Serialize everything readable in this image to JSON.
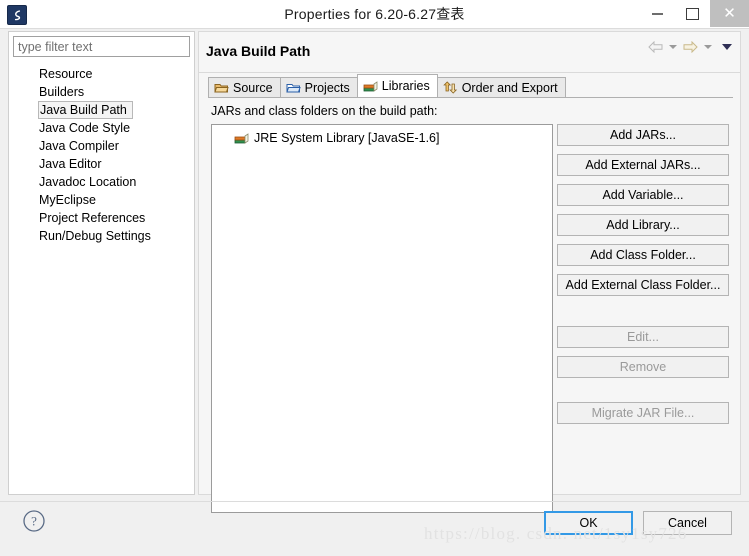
{
  "window": {
    "title": "Properties for 6.20-6.27查表",
    "app_icon": "myeclipse-icon",
    "controls": {
      "minimize": "minimize-icon",
      "maximize": "maximize-icon",
      "close": "close-icon"
    }
  },
  "sidebar": {
    "filter": {
      "placeholder": "type filter text",
      "value": ""
    },
    "items": [
      {
        "label": "Resource",
        "selected": false
      },
      {
        "label": "Builders",
        "selected": false
      },
      {
        "label": "Java Build Path",
        "selected": true
      },
      {
        "label": "Java Code Style",
        "selected": false
      },
      {
        "label": "Java Compiler",
        "selected": false
      },
      {
        "label": "Java Editor",
        "selected": false
      },
      {
        "label": "Javadoc Location",
        "selected": false
      },
      {
        "label": "MyEclipse",
        "selected": false
      },
      {
        "label": "Project References",
        "selected": false
      },
      {
        "label": "Run/Debug Settings",
        "selected": false
      }
    ]
  },
  "page": {
    "title": "Java Build Path",
    "nav": {
      "back": "back-arrow-icon",
      "back_menu": "back-dropdown-icon",
      "forward": "forward-arrow-icon",
      "forward_menu": "forward-dropdown-icon",
      "more": "view-menu-icon"
    },
    "tabs": [
      {
        "label": "Source",
        "icon": "source-folder-icon",
        "active": false
      },
      {
        "label": "Projects",
        "icon": "projects-folder-icon",
        "active": false
      },
      {
        "label": "Libraries",
        "icon": "libraries-books-icon",
        "active": true
      },
      {
        "label": "Order and Export",
        "icon": "order-export-icon",
        "active": false
      }
    ],
    "description": "JARs and class folders on the build path:",
    "entries": [
      {
        "label": "JRE System Library [JavaSE-1.6]",
        "icon": "libraries-books-icon"
      }
    ],
    "side_buttons": [
      {
        "label": "Add JARs...",
        "enabled": true
      },
      {
        "label": "Add External JARs...",
        "enabled": true
      },
      {
        "label": "Add Variable...",
        "enabled": true
      },
      {
        "label": "Add Library...",
        "enabled": true
      },
      {
        "label": "Add Class Folder...",
        "enabled": true
      },
      {
        "label": "Add External Class Folder...",
        "enabled": true
      },
      {
        "label": "Edit...",
        "enabled": false
      },
      {
        "label": "Remove",
        "enabled": false
      },
      {
        "label": "Migrate JAR File...",
        "enabled": false
      }
    ]
  },
  "footer": {
    "help": "help-icon",
    "ok_label": "OK",
    "cancel_label": "Cancel"
  },
  "watermark": "https://blog. csdn. net/1sy1sy726",
  "colors": {
    "accent": "#3399e6",
    "titlebar_bg": "#ffffff",
    "dialog_bg": "#f0f0f0",
    "panel_bg": "#f6f6f6",
    "close_hover": "#bfbfbf"
  }
}
